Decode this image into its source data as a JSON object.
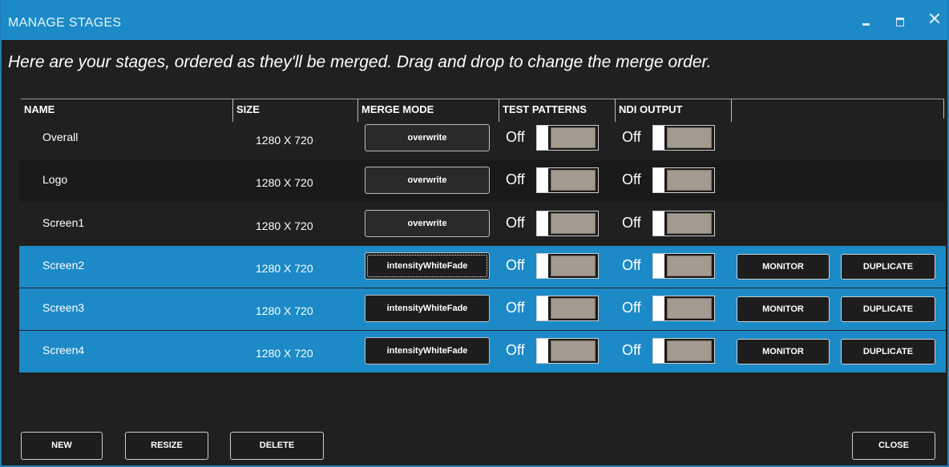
{
  "window": {
    "title": "MANAGE STAGES",
    "controls": {
      "minimize_icon": "minimize-icon",
      "maximize_icon": "maximize-icon",
      "close_glyph": "✕"
    }
  },
  "instructions": "Here are your stages, ordered as they'll be merged. Drag and drop to change the merge order.",
  "columns": {
    "name": "NAME",
    "size": "SIZE",
    "merge_mode": "MERGE MODE",
    "test_patterns": "TEST PATTERNS",
    "ndi_output": "NDI OUTPUT"
  },
  "stages": [
    {
      "name": "Overall",
      "size": "1280 X 720",
      "merge_mode": "overwrite",
      "test_patterns": "Off",
      "ndi_output": "Off",
      "selected": false
    },
    {
      "name": "Logo",
      "size": "1280 X 720",
      "merge_mode": "overwrite",
      "test_patterns": "Off",
      "ndi_output": "Off",
      "selected": false
    },
    {
      "name": "Screen1",
      "size": "1280 X 720",
      "merge_mode": "overwrite",
      "test_patterns": "Off",
      "ndi_output": "Off",
      "selected": false
    },
    {
      "name": "Screen2",
      "size": "1280 X 720",
      "merge_mode": "intensityWhiteFade",
      "test_patterns": "Off",
      "ndi_output": "Off",
      "selected": true,
      "monitor": "MONITOR",
      "duplicate": "DUPLICATE"
    },
    {
      "name": "Screen3",
      "size": "1280 X 720",
      "merge_mode": "intensityWhiteFade",
      "test_patterns": "Off",
      "ndi_output": "Off",
      "selected": true,
      "monitor": "MONITOR",
      "duplicate": "DUPLICATE"
    },
    {
      "name": "Screen4",
      "size": "1280 X 720",
      "merge_mode": "intensityWhiteFade",
      "test_patterns": "Off",
      "ndi_output": "Off",
      "selected": true,
      "monitor": "MONITOR",
      "duplicate": "DUPLICATE"
    }
  ],
  "footer": {
    "new": "NEW",
    "resize": "RESIZE",
    "delete": "DELETE",
    "close": "CLOSE"
  },
  "colors": {
    "titlebar": "#1c8ac7",
    "selected_row": "#1c8ac7",
    "background": "#202020",
    "toggle_track": "#a39b90"
  }
}
